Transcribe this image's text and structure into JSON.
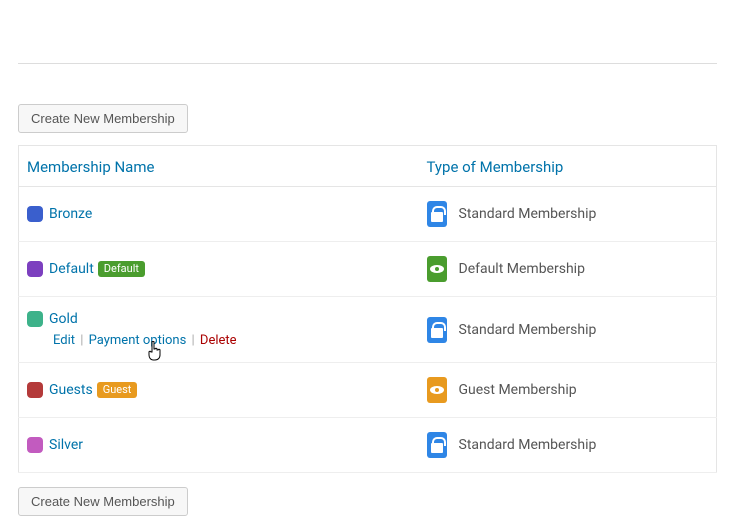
{
  "topButton": "Create New Membership",
  "bottomButton": "Create New Membership",
  "columns": {
    "name": "Membership Name",
    "type": "Type of Membership"
  },
  "rowActions": {
    "edit": "Edit",
    "payment": "Payment options",
    "delete": "Delete"
  },
  "rows": [
    {
      "name": "Bronze",
      "color": "#3a5fcd",
      "typeLabel": "Standard Membership",
      "typeIcon": "lock",
      "typeColor": "#2f86e6",
      "actions": false
    },
    {
      "name": "Default",
      "color": "#7c3fbf",
      "badge": "Default",
      "badgeColor": "#4a9d2e",
      "typeLabel": "Default Membership",
      "typeIcon": "eye",
      "typeColor": "#4a9d2e",
      "actions": false
    },
    {
      "name": "Gold",
      "color": "#3db28a",
      "typeLabel": "Standard Membership",
      "typeIcon": "lock",
      "typeColor": "#2f86e6",
      "actions": true
    },
    {
      "name": "Guests",
      "color": "#b43a3a",
      "badge": "Guest",
      "badgeColor": "#e89a1f",
      "typeLabel": "Guest Membership",
      "typeIcon": "eye",
      "typeColor": "#e89a1f",
      "actions": false
    },
    {
      "name": "Silver",
      "color": "#c25bbf",
      "typeLabel": "Standard Membership",
      "typeIcon": "lock",
      "typeColor": "#2f86e6",
      "actions": false
    }
  ]
}
